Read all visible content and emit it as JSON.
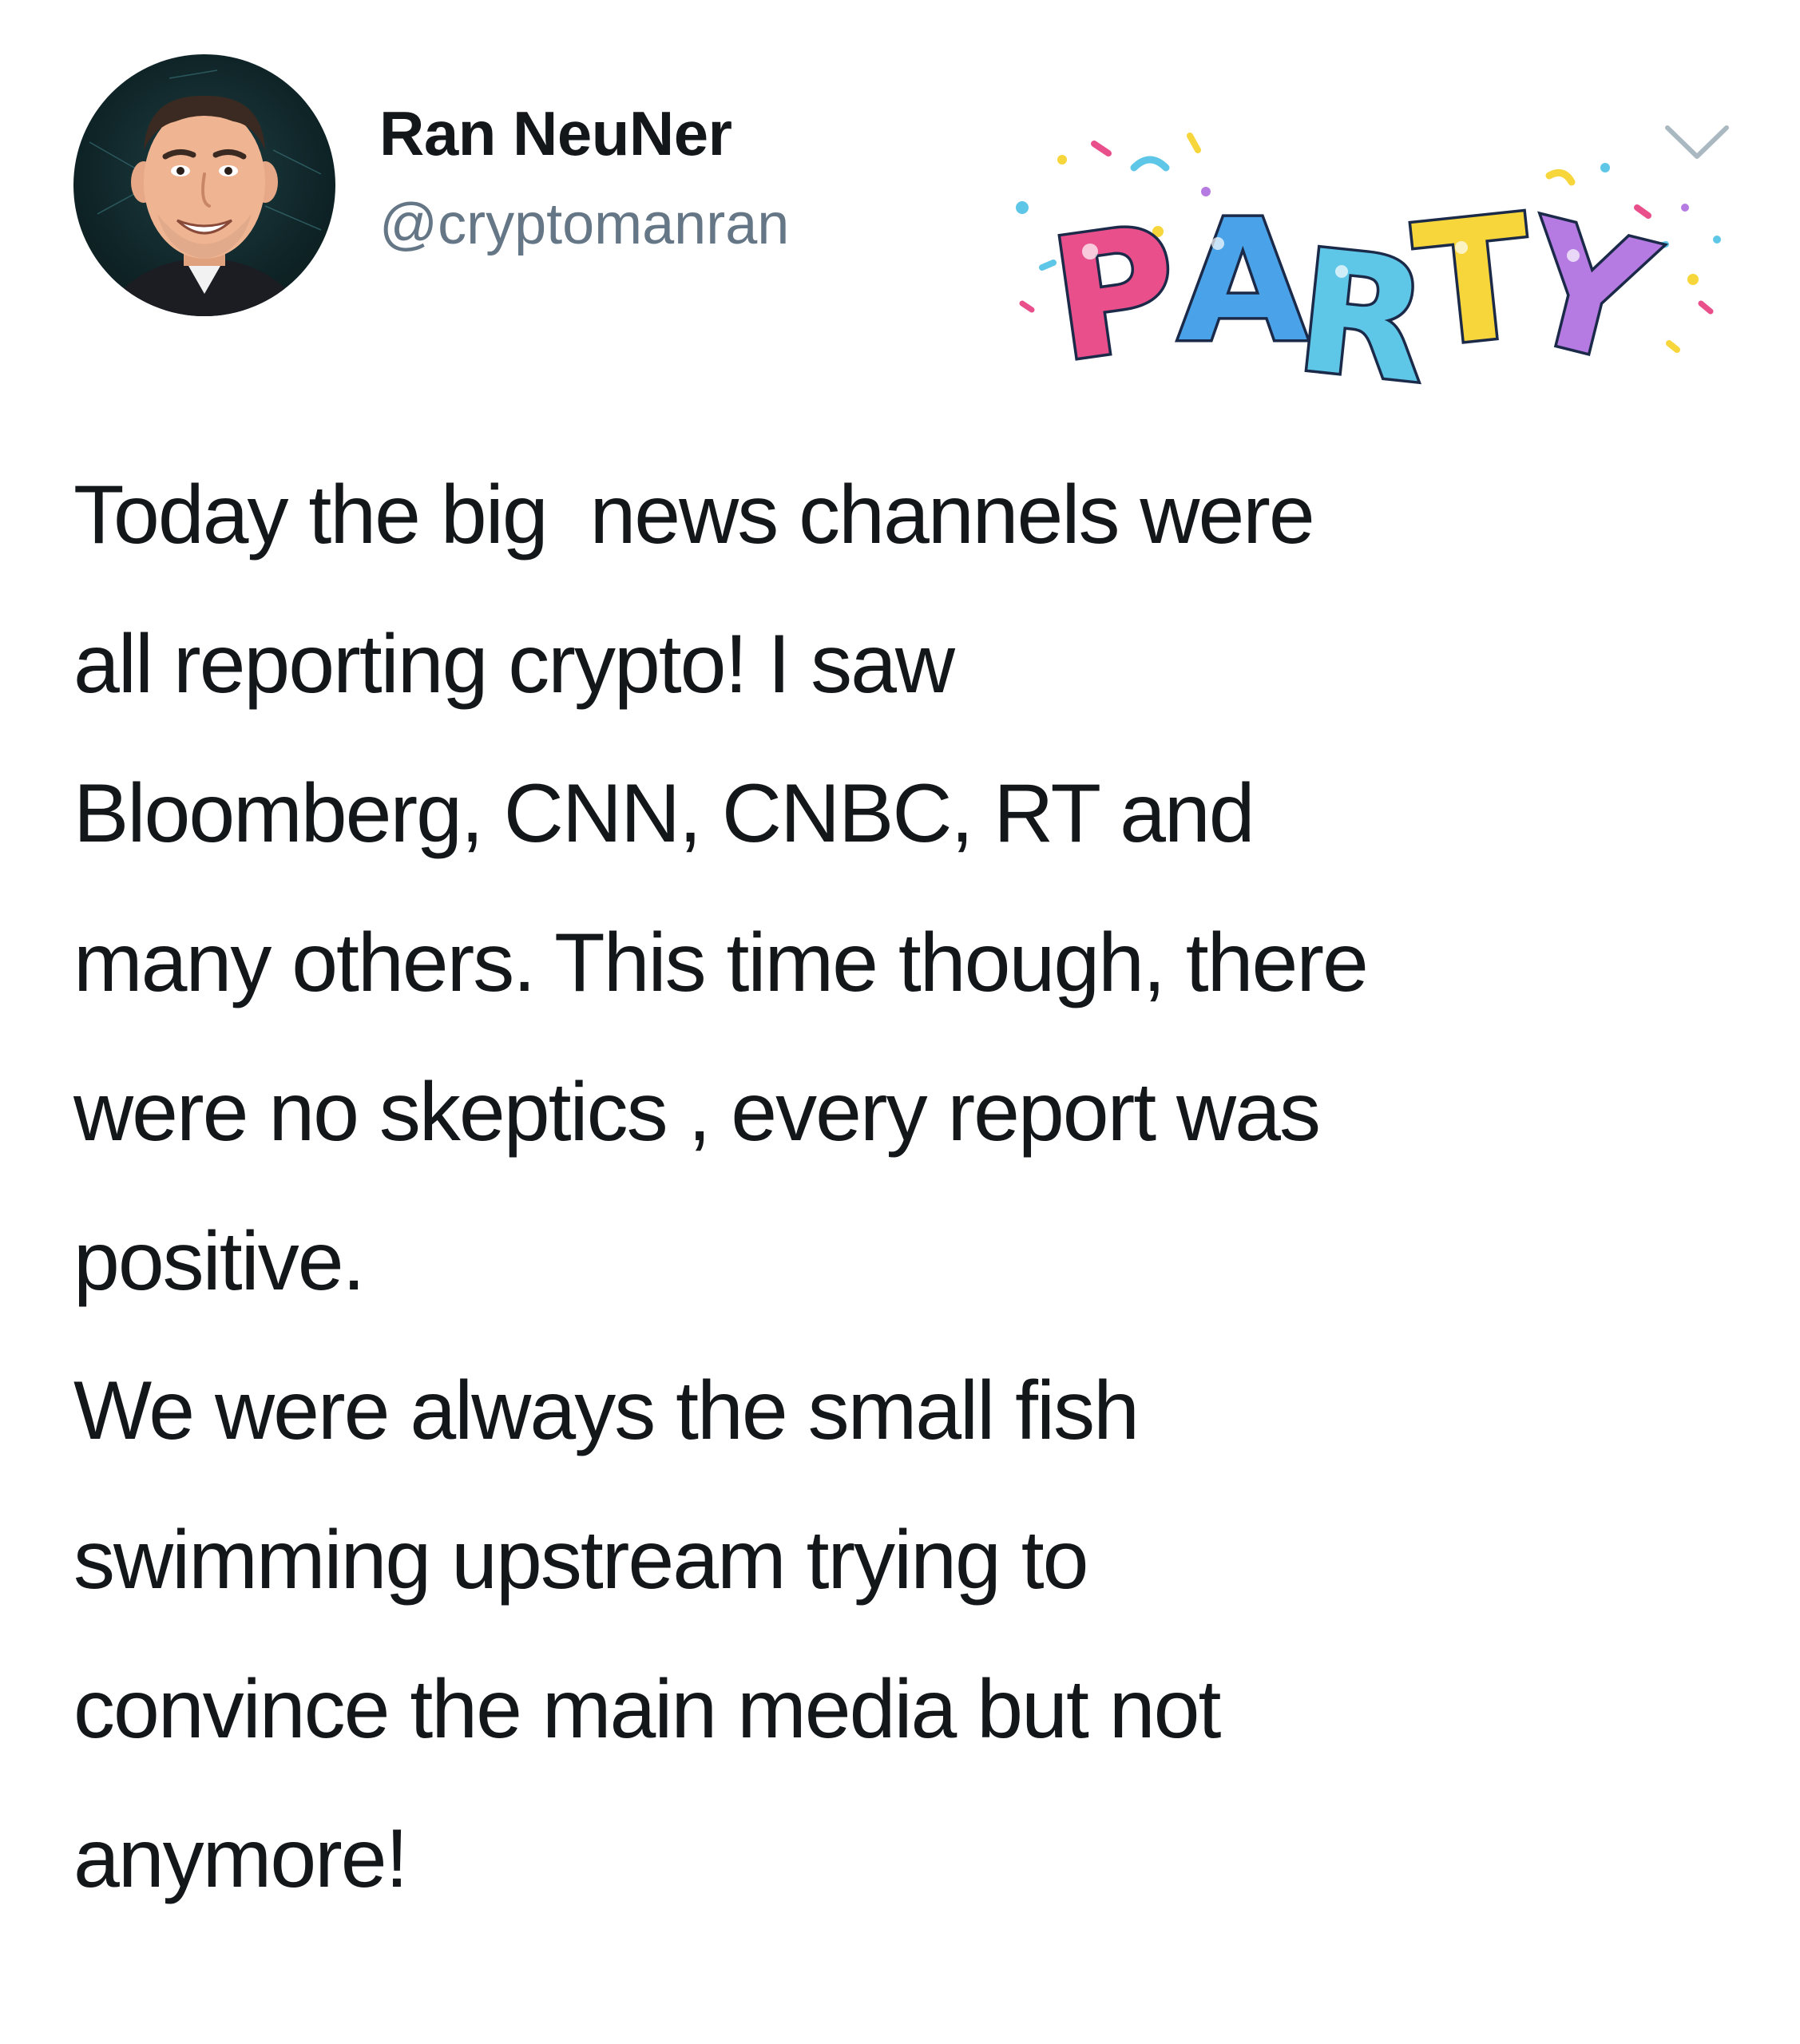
{
  "author": {
    "display_name": "Ran NeuNer",
    "handle": "@cryptomanran",
    "avatar_icon": "avatar-cartoon-portrait"
  },
  "sticker": {
    "icon": "party-sticker",
    "text": "PARTY",
    "colors": [
      "#e94f8a",
      "#4aa3e8",
      "#5ec7e8",
      "#f6d63a",
      "#b57be3"
    ]
  },
  "menu_icon": "chevron-down-icon",
  "tweet": {
    "lines": [
      "Today the big  news channels were",
      "all reporting crypto! I saw",
      "Bloomberg, CNN, CNBC, RT and",
      "many others. This time though, there",
      "were no skeptics , every report was",
      "positive.",
      "We were always the small fish",
      "swimming upstream trying to",
      "convince the main media but not",
      "anymore!"
    ]
  },
  "colors": {
    "text_primary": "#14171a",
    "text_secondary": "#657786",
    "background": "#ffffff"
  }
}
